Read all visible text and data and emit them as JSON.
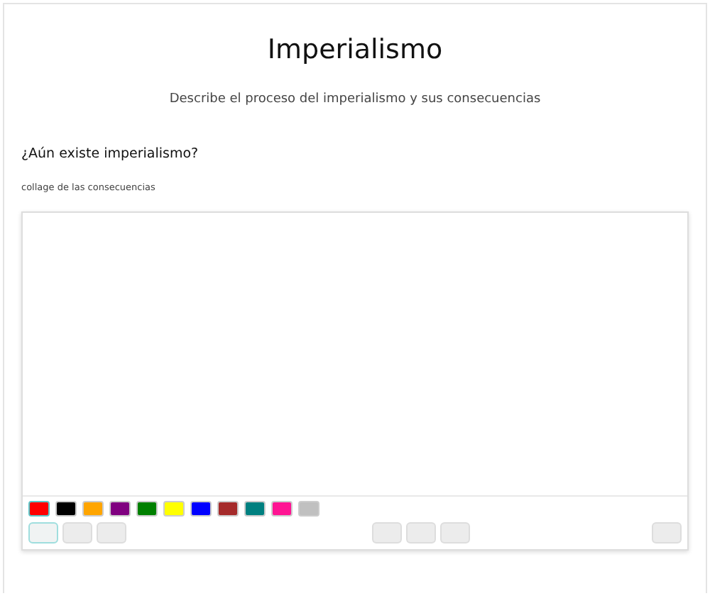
{
  "title": "Imperialismo",
  "description": "Describe el proceso del imperialismo y sus consecuencias",
  "question": "¿Aún existe imperialismo?",
  "hint": "collage de las consecuencias",
  "drawing_board": {
    "palette": [
      {
        "color": "#ff0000",
        "selected": true
      },
      {
        "color": "#000000",
        "selected": false
      },
      {
        "color": "#ffa500",
        "selected": false
      },
      {
        "color": "#800080",
        "selected": false
      },
      {
        "color": "#008000",
        "selected": false
      },
      {
        "color": "#ffff00",
        "selected": false
      },
      {
        "color": "#0000ff",
        "selected": false
      },
      {
        "color": "#a52a2a",
        "selected": false
      },
      {
        "color": "#008080",
        "selected": false
      },
      {
        "color": "#ff1493",
        "selected": false
      },
      {
        "color": "#c0c0c0",
        "selected": false
      }
    ],
    "tools": [
      {
        "selected": true
      },
      {
        "selected": false
      },
      {
        "selected": false
      }
    ],
    "actions": [
      {
        "selected": false
      },
      {
        "selected": false
      },
      {
        "selected": false
      }
    ],
    "end_tools": [
      {
        "selected": false
      }
    ]
  }
}
